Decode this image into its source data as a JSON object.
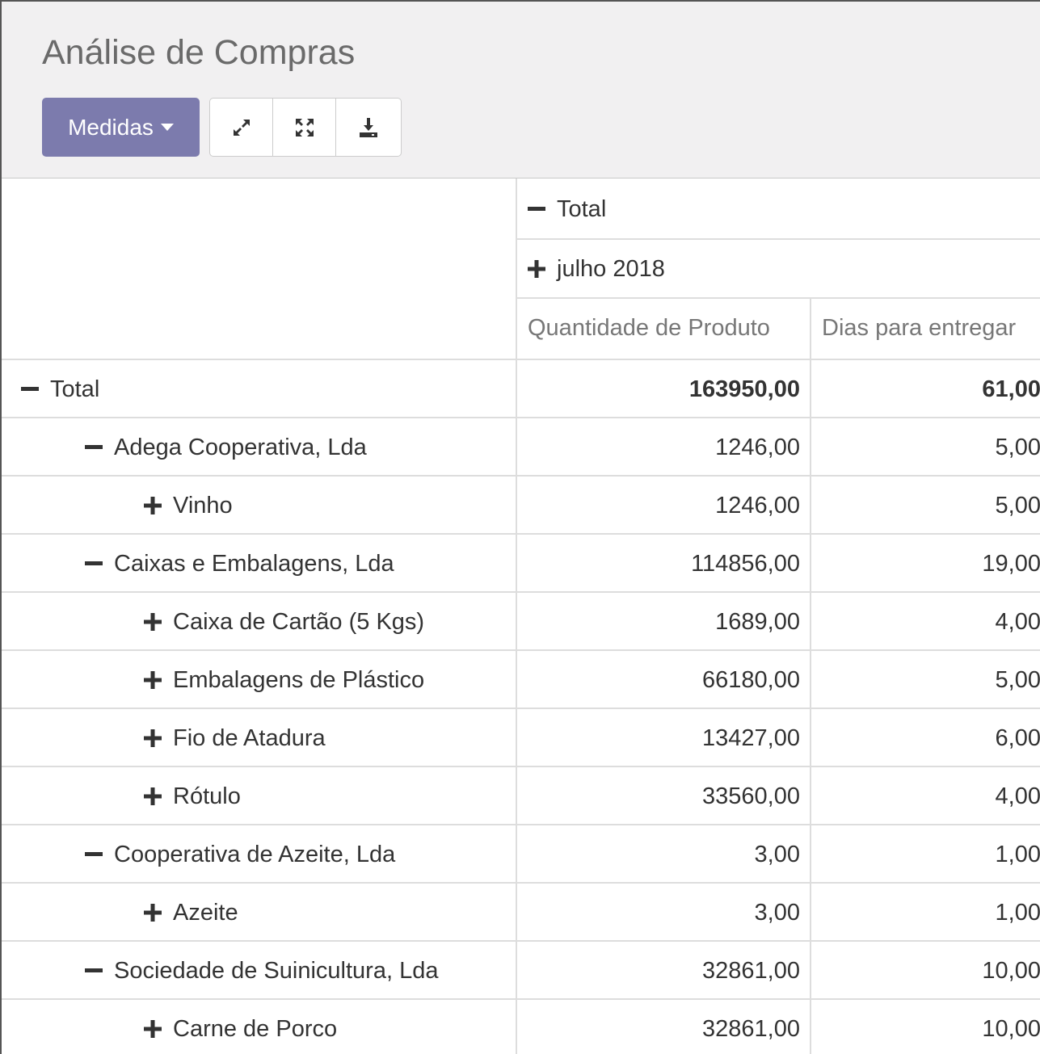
{
  "title": "Análise de Compras",
  "toolbar": {
    "measures_label": "Medidas",
    "icons": [
      "expand-icon",
      "fullscreen-icon",
      "download-icon"
    ]
  },
  "pivot": {
    "col_header_total": "Total",
    "col_header_period": "julho 2018",
    "measures": [
      "Quantidade de Produto",
      "Dias para entregar"
    ],
    "rows": [
      {
        "label": "Total",
        "level": 0,
        "expanded": true,
        "qty": "163950,00",
        "days": "61,00",
        "bold": true
      },
      {
        "label": "Adega Cooperativa, Lda",
        "level": 1,
        "expanded": true,
        "qty": "1246,00",
        "days": "5,00"
      },
      {
        "label": "Vinho",
        "level": 2,
        "expanded": false,
        "qty": "1246,00",
        "days": "5,00"
      },
      {
        "label": "Caixas e Embalagens, Lda",
        "level": 1,
        "expanded": true,
        "qty": "114856,00",
        "days": "19,00"
      },
      {
        "label": "Caixa de Cartão (5 Kgs)",
        "level": 2,
        "expanded": false,
        "qty": "1689,00",
        "days": "4,00"
      },
      {
        "label": "Embalagens de Plástico",
        "level": 2,
        "expanded": false,
        "qty": "66180,00",
        "days": "5,00"
      },
      {
        "label": "Fio de Atadura",
        "level": 2,
        "expanded": false,
        "qty": "13427,00",
        "days": "6,00"
      },
      {
        "label": "Rótulo",
        "level": 2,
        "expanded": false,
        "qty": "33560,00",
        "days": "4,00"
      },
      {
        "label": "Cooperativa de Azeite, Lda",
        "level": 1,
        "expanded": true,
        "qty": "3,00",
        "days": "1,00"
      },
      {
        "label": "Azeite",
        "level": 2,
        "expanded": false,
        "qty": "3,00",
        "days": "1,00"
      },
      {
        "label": "Sociedade de Suinicultura, Lda",
        "level": 1,
        "expanded": true,
        "qty": "32861,00",
        "days": "10,00"
      },
      {
        "label": "Carne de Porco",
        "level": 2,
        "expanded": false,
        "qty": "32861,00",
        "days": "10,00"
      }
    ]
  },
  "colors": {
    "primary": "#7c7bad",
    "panel_bg": "#f1f0f1",
    "border": "#dddddd"
  }
}
